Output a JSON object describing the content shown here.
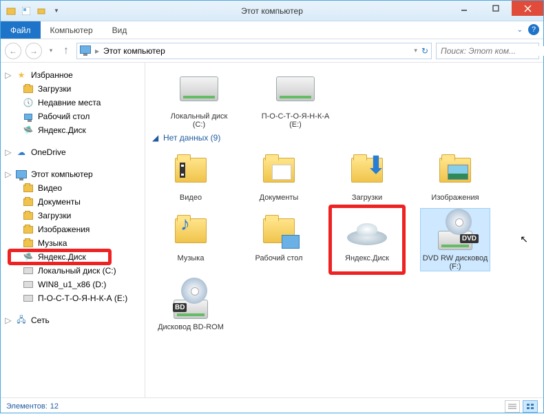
{
  "titlebar": {
    "title": "Этот компьютер"
  },
  "ribbon": {
    "file": "Файл",
    "computer": "Компьютер",
    "view": "Вид"
  },
  "address": {
    "location": "Этот компьютер",
    "search_placeholder": "Поиск: Этот ком..."
  },
  "sidebar": {
    "favorites": {
      "header": "Избранное",
      "items": [
        "Загрузки",
        "Недавние места",
        "Рабочий стол",
        "Яндекс.Диск"
      ]
    },
    "onedrive": "OneDrive",
    "thispc": {
      "header": "Этот компьютер",
      "items": [
        "Видео",
        "Документы",
        "Загрузки",
        "Изображения",
        "Музыка",
        "Яндекс.Диск",
        "Локальный диск (C:)",
        "WIN8_u1_x86 (D:)",
        "П-О-С-Т-О-Я-Н-К-А (E:)"
      ]
    },
    "network": "Сеть"
  },
  "content": {
    "top_items": [
      {
        "label": "Локальный диск (C:)"
      },
      {
        "label": "П-О-С-Т-О-Я-Н-К-А (E:)"
      }
    ],
    "section_header": "Нет данных (9)",
    "items": [
      "Видео",
      "Документы",
      "Загрузки",
      "Изображения",
      "Музыка",
      "Рабочий стол",
      "Яндекс.Диск",
      "DVD RW дисковод (F:)",
      "Дисковод BD-ROM"
    ]
  },
  "status": {
    "count_label": "Элементов:",
    "count_value": "12"
  }
}
